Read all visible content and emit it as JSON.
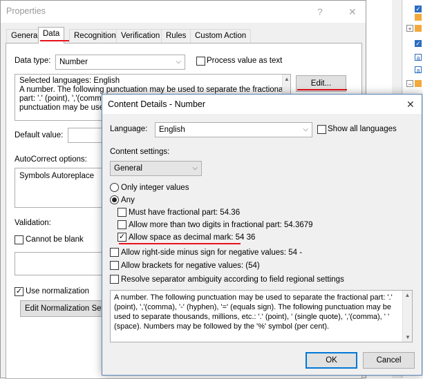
{
  "props": {
    "title": "Properties",
    "help_glyph": "?",
    "close_glyph": "✕",
    "tabs": [
      "General",
      "Data",
      "Recognition",
      "Verification",
      "Rules",
      "Custom Action"
    ],
    "data_type_label": "Data type:",
    "data_type_value": "Number",
    "process_as_text_label": "Process value as text",
    "description_lines": [
      "Selected languages: English",
      "A number. The following punctuation may be used to separate the fractional",
      "part: '.' (point), ','(comma",
      "punctuation may be used"
    ],
    "edit_button": "Edit...",
    "default_value_label": "Default value:",
    "autocorrect_label": "AutoCorrect options:",
    "autocorrect_item": "Symbols Autoreplace",
    "validation_label": "Validation:",
    "cannot_be_blank_label": "Cannot be blank",
    "use_normalization_label": "Use normalization",
    "edit_normalization_button": "Edit Normalization Setti"
  },
  "dialog": {
    "title": "Content Details - Number",
    "close_glyph": "✕",
    "language_label": "Language:",
    "language_value": "English",
    "show_all_languages_label": "Show all languages",
    "content_settings_label": "Content settings:",
    "content_settings_value": "General",
    "only_integer_label": "Only integer values",
    "any_label": "Any",
    "must_have_fractional_label": "Must have fractional part:  54.36",
    "allow_more_digits_label": "Allow more than two digits in fractional part:  54.3679",
    "allow_space_decimal_label": "Allow space as decimal mark:  54 36",
    "allow_right_minus_label": "Allow right-side minus sign for negative values:  54 -",
    "allow_brackets_label": "Allow brackets for negative values:  (54)",
    "resolve_ambiguity_label": "Resolve separator ambiguity according to field regional settings",
    "description_lines": [
      "A number. The following punctuation may be used to separate the fractional part: '.'",
      "(point), ','(comma),  '-' (hyphen), '=' (equals sign).  The following punctuation may be",
      "used to separate thousands, millions, etc.: '.' (point), ' (single quote), ','(comma), ' '",
      "(space). Numbers may be followed by the '%' symbol (per cent)."
    ],
    "ok_button": "OK",
    "cancel_button": "Cancel"
  },
  "colors": {
    "highlight_red": "#e8101a",
    "focus_blue": "#0078d7"
  }
}
